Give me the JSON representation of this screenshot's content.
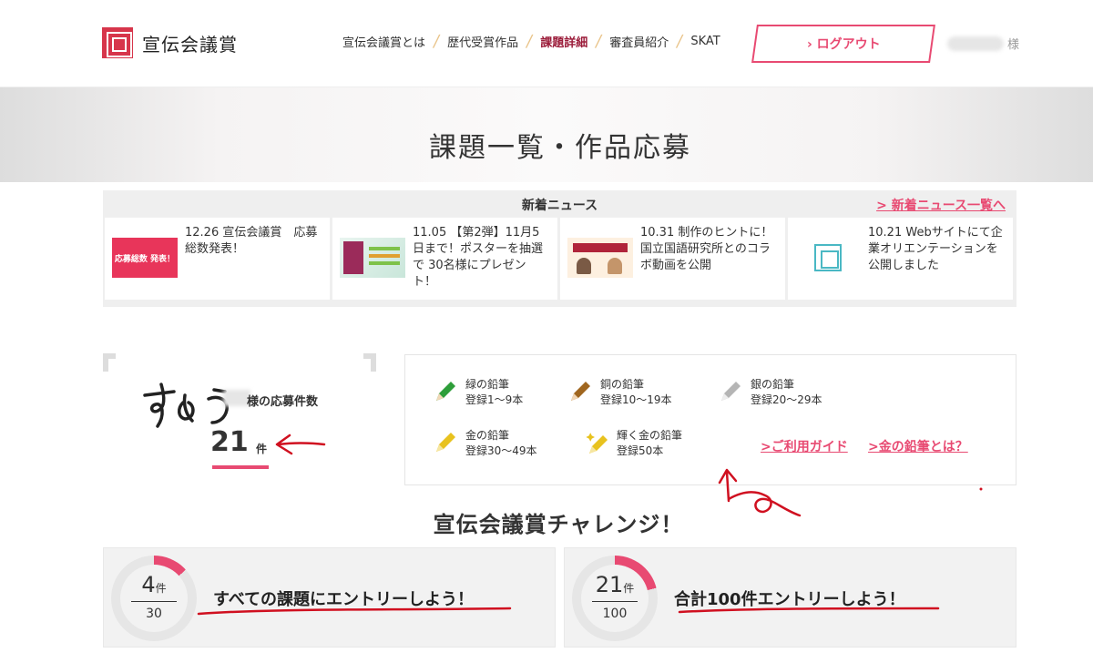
{
  "header": {
    "logo_text": "宣伝会議賞",
    "nav": [
      {
        "label": "宣伝会議賞とは",
        "active": false
      },
      {
        "label": "歴代受賞作品",
        "active": false
      },
      {
        "label": "課題詳細",
        "active": true
      },
      {
        "label": "審査員紹介",
        "active": false
      },
      {
        "label": "SKAT",
        "active": false
      }
    ],
    "logout_label": "› ログアウト",
    "user_suffix": "様"
  },
  "hero": {
    "title": "課題一覧・作品応募"
  },
  "news": {
    "title": "新着ニュース",
    "all_link": "> 新着ニュース一覧へ",
    "items": [
      {
        "text": "12.26 宣伝会議賞　応募総数発表！",
        "thumb_label": "応募総数 発表！",
        "thumb": "announcement-thumbnail"
      },
      {
        "text": "11.05 【第2弾】11月5日まで！ポスターを抽選で 30名様にプレゼント！",
        "thumb": "poster-thumbnail"
      },
      {
        "text": "10.31 制作のヒントに！国立国語研究所とのコラボ動画を公開",
        "thumb": "video-thumbnail"
      },
      {
        "text": "10.21 Webサイトにて企業オリエンテーションを公開しました",
        "thumb": "logo-thumbnail"
      }
    ]
  },
  "entries": {
    "label": "様の応募件数",
    "count": "21",
    "unit": "件"
  },
  "pencils": {
    "items": [
      {
        "name": "緑の鉛筆",
        "range": "登録1〜9本",
        "color": "#2e9e3a",
        "icon": "green-pencil-icon"
      },
      {
        "name": "銅の鉛筆",
        "range": "登録10〜19本",
        "color": "#a0661f",
        "icon": "bronze-pencil-icon"
      },
      {
        "name": "銀の鉛筆",
        "range": "登録20〜29本",
        "color": "#b5b5b5",
        "icon": "silver-pencil-icon"
      },
      {
        "name": "金の鉛筆",
        "range": "登録30〜49本",
        "color": "#e8c21e",
        "icon": "gold-pencil-icon"
      },
      {
        "name": "輝く金の鉛筆",
        "range": "登録50本",
        "color": "#e8c21e",
        "icon": "shining-gold-pencil-icon"
      }
    ],
    "guide_link": ">ご利用ガイド",
    "gold_link": ">金の鉛筆とは？"
  },
  "challenge": {
    "title": "宣伝会議賞チャレンジ！",
    "cards": [
      {
        "count": "4",
        "unit": "件",
        "total": "30",
        "text": "すべての課題にエントリーしよう！",
        "progress": 0.133,
        "accent": "#e84a72"
      },
      {
        "count": "21",
        "unit": "件",
        "total": "100",
        "text": "合計100件エントリーしよう！",
        "progress": 0.21,
        "accent": "#e84a72"
      }
    ]
  }
}
